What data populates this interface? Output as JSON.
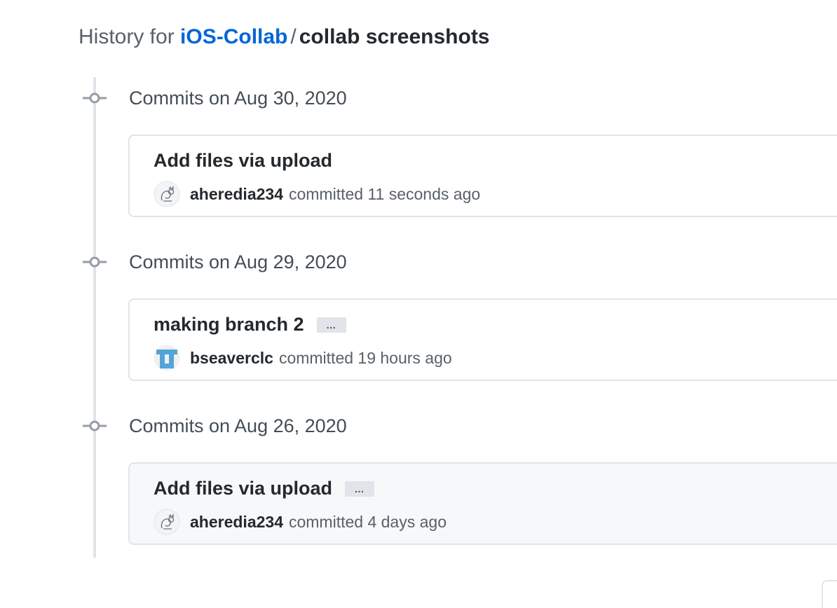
{
  "header": {
    "prefix": "History for",
    "repo": "iOS-Collab",
    "separator": "/",
    "path": "collab screenshots"
  },
  "groups": [
    {
      "heading": "Commits on Aug 30, 2020",
      "commit": {
        "message": "Add files via upload",
        "author": "aheredia234",
        "committed": "committed 11 seconds ago",
        "avatar": "squirrel-avatar",
        "has_ellipsis": false
      }
    },
    {
      "heading": "Commits on Aug 29, 2020",
      "commit": {
        "message": "making branch 2",
        "author": "bseaverclc",
        "committed": "committed 19 hours ago",
        "avatar": "blue-identicon-avatar",
        "has_ellipsis": true,
        "ellipsis": "…"
      }
    },
    {
      "heading": "Commits on Aug 26, 2020",
      "commit": {
        "message": "Add files via upload",
        "author": "aheredia234",
        "committed": "committed 4 days ago",
        "avatar": "squirrel-avatar",
        "has_ellipsis": true,
        "ellipsis": "…"
      }
    }
  ],
  "colors": {
    "link": "#0366d6",
    "timeline": "#e1e4e8",
    "avatar_blue": "#54a3d9"
  }
}
